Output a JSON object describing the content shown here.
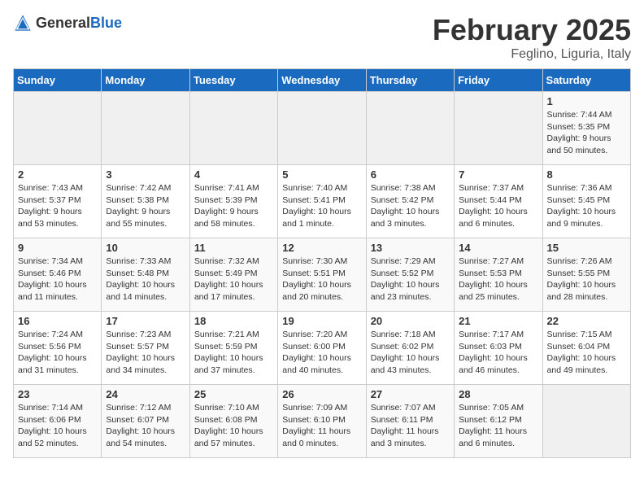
{
  "header": {
    "logo_general": "General",
    "logo_blue": "Blue",
    "month_title": "February 2025",
    "subtitle": "Feglino, Liguria, Italy"
  },
  "days_of_week": [
    "Sunday",
    "Monday",
    "Tuesday",
    "Wednesday",
    "Thursday",
    "Friday",
    "Saturday"
  ],
  "weeks": [
    [
      {
        "day": "",
        "info": "",
        "empty": true
      },
      {
        "day": "",
        "info": "",
        "empty": true
      },
      {
        "day": "",
        "info": "",
        "empty": true
      },
      {
        "day": "",
        "info": "",
        "empty": true
      },
      {
        "day": "",
        "info": "",
        "empty": true
      },
      {
        "day": "",
        "info": "",
        "empty": true
      },
      {
        "day": "1",
        "info": "Sunrise: 7:44 AM\nSunset: 5:35 PM\nDaylight: 9 hours\nand 50 minutes."
      }
    ],
    [
      {
        "day": "2",
        "info": "Sunrise: 7:43 AM\nSunset: 5:37 PM\nDaylight: 9 hours\nand 53 minutes."
      },
      {
        "day": "3",
        "info": "Sunrise: 7:42 AM\nSunset: 5:38 PM\nDaylight: 9 hours\nand 55 minutes."
      },
      {
        "day": "4",
        "info": "Sunrise: 7:41 AM\nSunset: 5:39 PM\nDaylight: 9 hours\nand 58 minutes."
      },
      {
        "day": "5",
        "info": "Sunrise: 7:40 AM\nSunset: 5:41 PM\nDaylight: 10 hours\nand 1 minute."
      },
      {
        "day": "6",
        "info": "Sunrise: 7:38 AM\nSunset: 5:42 PM\nDaylight: 10 hours\nand 3 minutes."
      },
      {
        "day": "7",
        "info": "Sunrise: 7:37 AM\nSunset: 5:44 PM\nDaylight: 10 hours\nand 6 minutes."
      },
      {
        "day": "8",
        "info": "Sunrise: 7:36 AM\nSunset: 5:45 PM\nDaylight: 10 hours\nand 9 minutes."
      }
    ],
    [
      {
        "day": "9",
        "info": "Sunrise: 7:34 AM\nSunset: 5:46 PM\nDaylight: 10 hours\nand 11 minutes."
      },
      {
        "day": "10",
        "info": "Sunrise: 7:33 AM\nSunset: 5:48 PM\nDaylight: 10 hours\nand 14 minutes."
      },
      {
        "day": "11",
        "info": "Sunrise: 7:32 AM\nSunset: 5:49 PM\nDaylight: 10 hours\nand 17 minutes."
      },
      {
        "day": "12",
        "info": "Sunrise: 7:30 AM\nSunset: 5:51 PM\nDaylight: 10 hours\nand 20 minutes."
      },
      {
        "day": "13",
        "info": "Sunrise: 7:29 AM\nSunset: 5:52 PM\nDaylight: 10 hours\nand 23 minutes."
      },
      {
        "day": "14",
        "info": "Sunrise: 7:27 AM\nSunset: 5:53 PM\nDaylight: 10 hours\nand 25 minutes."
      },
      {
        "day": "15",
        "info": "Sunrise: 7:26 AM\nSunset: 5:55 PM\nDaylight: 10 hours\nand 28 minutes."
      }
    ],
    [
      {
        "day": "16",
        "info": "Sunrise: 7:24 AM\nSunset: 5:56 PM\nDaylight: 10 hours\nand 31 minutes."
      },
      {
        "day": "17",
        "info": "Sunrise: 7:23 AM\nSunset: 5:57 PM\nDaylight: 10 hours\nand 34 minutes."
      },
      {
        "day": "18",
        "info": "Sunrise: 7:21 AM\nSunset: 5:59 PM\nDaylight: 10 hours\nand 37 minutes."
      },
      {
        "day": "19",
        "info": "Sunrise: 7:20 AM\nSunset: 6:00 PM\nDaylight: 10 hours\nand 40 minutes."
      },
      {
        "day": "20",
        "info": "Sunrise: 7:18 AM\nSunset: 6:02 PM\nDaylight: 10 hours\nand 43 minutes."
      },
      {
        "day": "21",
        "info": "Sunrise: 7:17 AM\nSunset: 6:03 PM\nDaylight: 10 hours\nand 46 minutes."
      },
      {
        "day": "22",
        "info": "Sunrise: 7:15 AM\nSunset: 6:04 PM\nDaylight: 10 hours\nand 49 minutes."
      }
    ],
    [
      {
        "day": "23",
        "info": "Sunrise: 7:14 AM\nSunset: 6:06 PM\nDaylight: 10 hours\nand 52 minutes."
      },
      {
        "day": "24",
        "info": "Sunrise: 7:12 AM\nSunset: 6:07 PM\nDaylight: 10 hours\nand 54 minutes."
      },
      {
        "day": "25",
        "info": "Sunrise: 7:10 AM\nSunset: 6:08 PM\nDaylight: 10 hours\nand 57 minutes."
      },
      {
        "day": "26",
        "info": "Sunrise: 7:09 AM\nSunset: 6:10 PM\nDaylight: 11 hours\nand 0 minutes."
      },
      {
        "day": "27",
        "info": "Sunrise: 7:07 AM\nSunset: 6:11 PM\nDaylight: 11 hours\nand 3 minutes."
      },
      {
        "day": "28",
        "info": "Sunrise: 7:05 AM\nSunset: 6:12 PM\nDaylight: 11 hours\nand 6 minutes."
      },
      {
        "day": "",
        "info": "",
        "empty": true
      }
    ]
  ]
}
